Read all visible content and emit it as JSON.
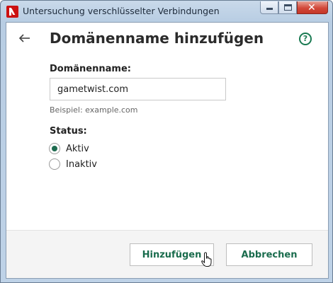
{
  "window": {
    "title": "Untersuchung verschlüsselter Verbindungen",
    "controls": [
      "minimize-icon",
      "maximize-icon",
      "close-icon"
    ]
  },
  "header": {
    "back_icon": "back-arrow-icon",
    "title": "Domänenname hinzufügen",
    "help_icon": "help-icon",
    "help_glyph": "?"
  },
  "form": {
    "domain_label": "Domänenname:",
    "domain_value": "gametwist.com",
    "domain_hint": "Beispiel: example.com",
    "status_label": "Status:",
    "status_options": [
      {
        "label": "Aktiv",
        "selected": true
      },
      {
        "label": "Inaktiv",
        "selected": false
      }
    ]
  },
  "footer": {
    "add_label": "Hinzufügen",
    "cancel_label": "Abbrechen"
  },
  "colors": {
    "accent": "#1a6c4d",
    "close_button": "#c43526",
    "brand_icon": "#cc1111"
  }
}
